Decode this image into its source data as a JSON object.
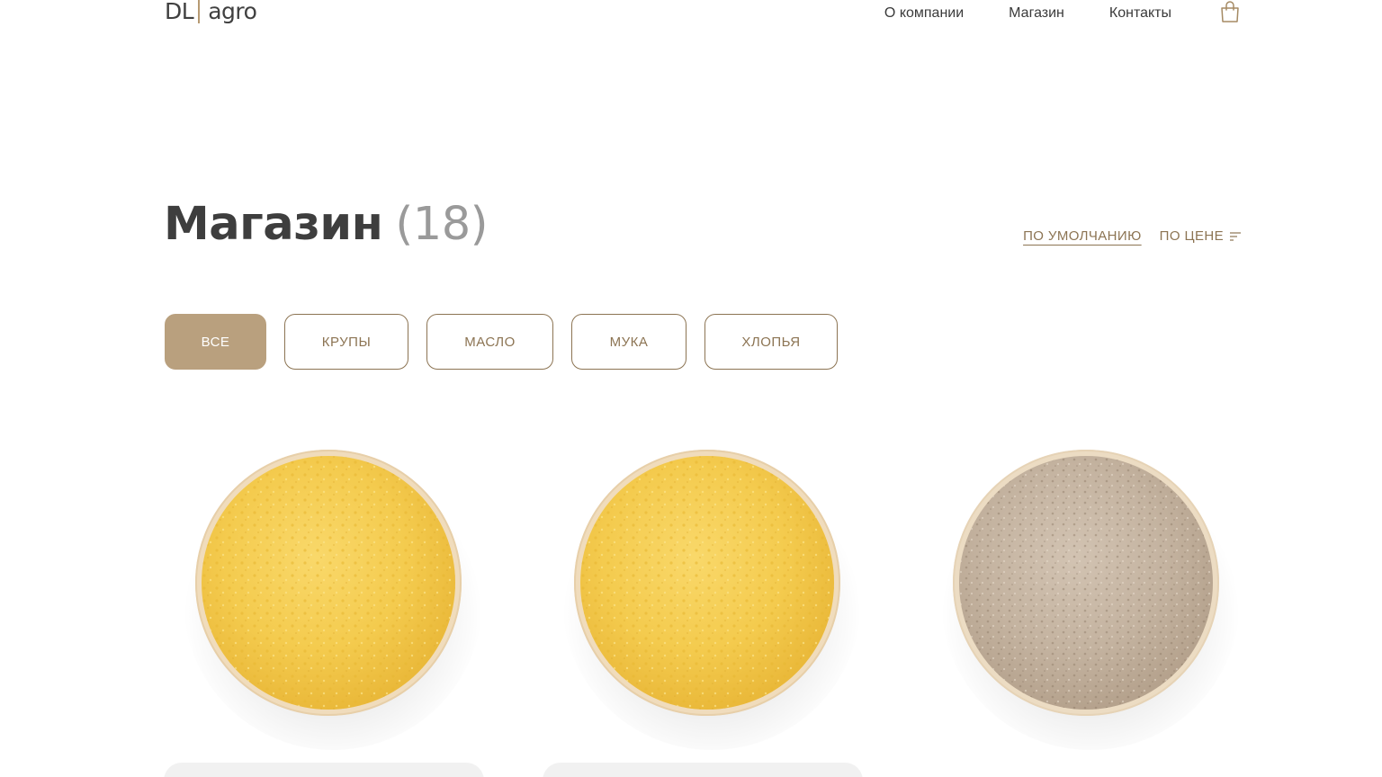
{
  "header": {
    "logo_left": "DL",
    "logo_right": "agro",
    "nav": [
      "О компании",
      "Магазин",
      "Контакты"
    ],
    "cart_icon": "shopping-bag-icon"
  },
  "main": {
    "title": "Магазин",
    "count": "(18)",
    "sort": {
      "default_label": "ПО УМОЛЧАНИЮ",
      "price_label": "ПО ЦЕНЕ",
      "icon": "sort-icon"
    },
    "filters": [
      {
        "label": "ВСЕ",
        "active": true
      },
      {
        "label": "КРУПЫ",
        "active": false
      },
      {
        "label": "МАСЛО",
        "active": false
      },
      {
        "label": "МУКА",
        "active": false
      },
      {
        "label": "ХЛОПЬЯ",
        "active": false
      }
    ]
  },
  "products": [
    {
      "image": "yellow-flour-bowl"
    },
    {
      "image": "yellow-flour-bowl"
    },
    {
      "image": "grey-flour-bowl"
    }
  ],
  "colors": {
    "accent": "#b9a07e",
    "accent_text": "#8c7453",
    "text": "#3a3a3a",
    "muted": "#9a9a9a"
  }
}
